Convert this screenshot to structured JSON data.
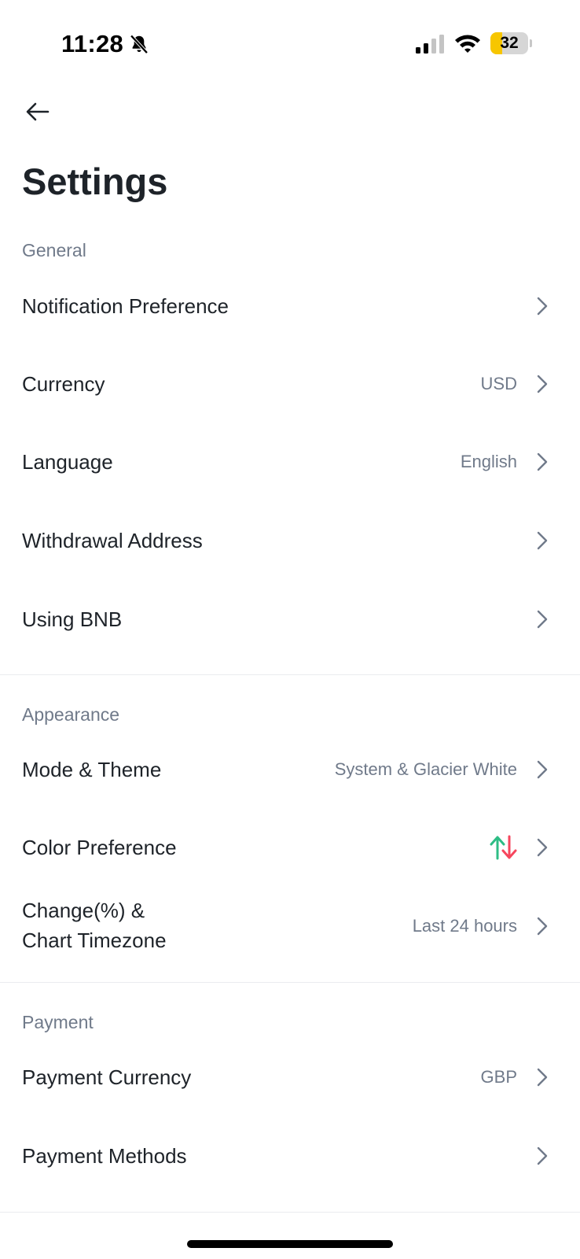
{
  "status_bar": {
    "time": "11:28",
    "battery_level": "32",
    "battery_fraction": 0.32,
    "icons": [
      "bell-slash-icon",
      "cellular-signal-icon",
      "wifi-icon",
      "battery-icon"
    ]
  },
  "header": {
    "back_icon": "arrow-left-icon",
    "title": "Settings"
  },
  "general": {
    "header": "General",
    "items": [
      {
        "label": "Notification Preference",
        "value": ""
      },
      {
        "label": "Currency",
        "value": "USD"
      },
      {
        "label": "Language",
        "value": "English"
      },
      {
        "label": "Withdrawal Address",
        "value": ""
      },
      {
        "label": "Using BNB",
        "value": ""
      }
    ]
  },
  "appearance": {
    "header": "Appearance",
    "items": [
      {
        "label": "Mode & Theme",
        "value": "System & Glacier White"
      },
      {
        "label": "Color Preference",
        "value": "",
        "icon": "up-down-arrows-icon"
      },
      {
        "label_line1": "Change(%) &",
        "label_line2": "Chart Timezone",
        "value": "Last 24 hours"
      }
    ]
  },
  "payment": {
    "header": "Payment",
    "items": [
      {
        "label": "Payment Currency",
        "value": "GBP"
      },
      {
        "label": "Payment Methods",
        "value": ""
      }
    ]
  },
  "colors": {
    "up": "#2ebd85",
    "down": "#f6465d",
    "text_primary": "#1e2329",
    "text_secondary": "#707a8a",
    "battery": "#f7c600"
  }
}
